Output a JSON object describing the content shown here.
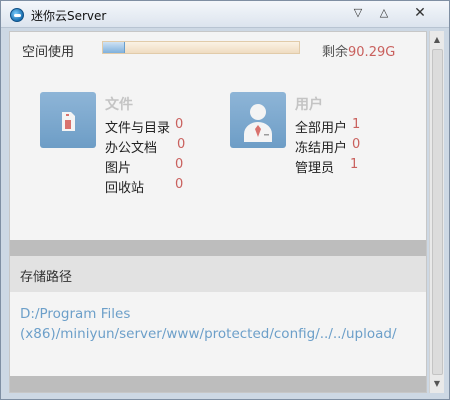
{
  "window": {
    "title": "迷你云Server"
  },
  "titlebar_buttons": {
    "minimize": "▽",
    "maximize": "△",
    "close": "✕"
  },
  "storage": {
    "label": "空间使用",
    "used_fraction": 0.11,
    "remaining_label": "剩余",
    "remaining_value": "90.29G"
  },
  "files": {
    "heading": "文件",
    "icon": "file-icon",
    "rows": [
      {
        "label": "文件与目录",
        "value": "0"
      },
      {
        "label": "办公文档",
        "value": "0"
      },
      {
        "label": "图片",
        "value": "0"
      },
      {
        "label": "回收站",
        "value": "0"
      }
    ]
  },
  "users": {
    "heading": "用户",
    "icon": "user-icon",
    "rows": [
      {
        "label": "全部用户",
        "value": "1"
      },
      {
        "label": "冻结用户",
        "value": "0"
      },
      {
        "label": "管理员",
        "value": "1"
      }
    ]
  },
  "path": {
    "header": "存储路径",
    "line1": "D:/Program Files",
    "line2": "(x86)/miniyun/server/www/protected/config/../../upload/"
  },
  "colors": {
    "accent_value": "#c9605d",
    "link": "#6c9fc9",
    "tile_bg": "#7ea9cf"
  }
}
